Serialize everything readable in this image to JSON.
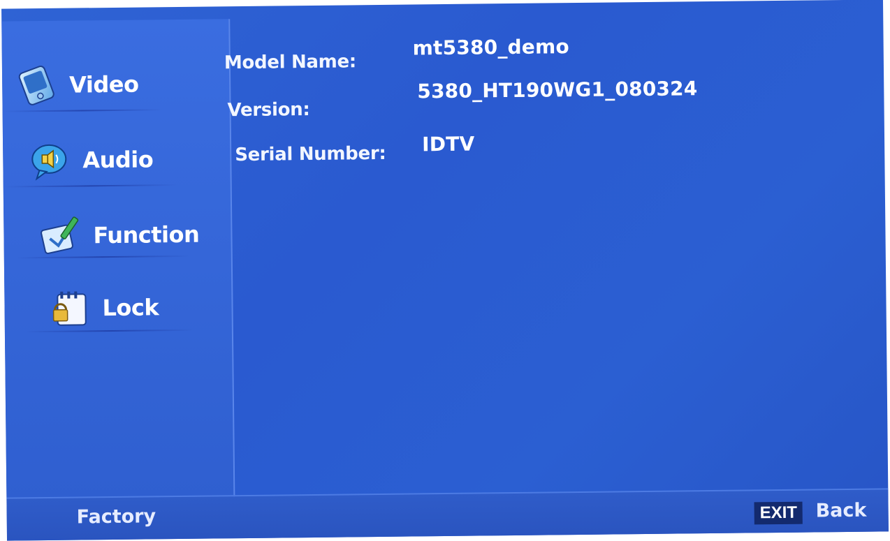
{
  "sidebar": {
    "items": [
      {
        "label": "Video",
        "icon": "video-icon"
      },
      {
        "label": "Audio",
        "icon": "audio-speaker-icon"
      },
      {
        "label": "Function",
        "icon": "function-pen-icon"
      },
      {
        "label": "Lock",
        "icon": "lock-icon"
      }
    ]
  },
  "info": {
    "model_name_label": "Model Name:",
    "model_name_value": "mt5380_demo",
    "version_label": "Version:",
    "version_value": "5380_HT190WG1_080324",
    "serial_label": "Serial Number:",
    "serial_value": "IDTV"
  },
  "footer": {
    "title": "Factory",
    "exit_key": "EXIT",
    "back_label": "Back"
  },
  "colors": {
    "background": "#2b5fd2",
    "sidebar": "#3566d8",
    "text": "#ffffff",
    "exit_key_bg": "#132a6e"
  }
}
